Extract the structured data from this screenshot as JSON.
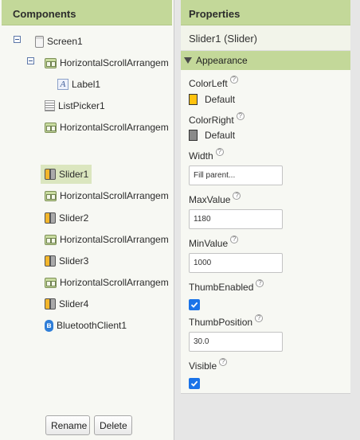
{
  "components": {
    "header": "Components",
    "tree": [
      {
        "label": "Screen1",
        "icon": "screen-icon"
      },
      {
        "label": "HorizontalScrollArrangem",
        "icon": "horizontal-scroll-arrangement-icon"
      },
      {
        "label": "Label1",
        "icon": "label-icon"
      },
      {
        "label": "ListPicker1",
        "icon": "listpicker-icon"
      },
      {
        "label": "HorizontalScrollArrangem",
        "icon": "horizontal-scroll-arrangement-icon"
      },
      {
        "label": "Slider1",
        "icon": "slider-icon",
        "selected": true
      },
      {
        "label": "HorizontalScrollArrangem",
        "icon": "horizontal-scroll-arrangement-icon"
      },
      {
        "label": "Slider2",
        "icon": "slider-icon"
      },
      {
        "label": "HorizontalScrollArrangem",
        "icon": "horizontal-scroll-arrangement-icon"
      },
      {
        "label": "Slider3",
        "icon": "slider-icon"
      },
      {
        "label": "HorizontalScrollArrangem",
        "icon": "horizontal-scroll-arrangement-icon"
      },
      {
        "label": "Slider4",
        "icon": "slider-icon"
      },
      {
        "label": "BluetoothClient1",
        "icon": "bluetooth-icon"
      }
    ],
    "rename_label": "Rename",
    "delete_label": "Delete"
  },
  "properties": {
    "header": "Properties",
    "component_title": "Slider1 (Slider)",
    "section": "Appearance",
    "help_glyph": "?",
    "color_left": {
      "name": "ColorLeft",
      "value": "Default",
      "color": "#ffc20e"
    },
    "color_right": {
      "name": "ColorRight",
      "value": "Default",
      "color": "#8a8a8a"
    },
    "width": {
      "name": "Width",
      "value": "Fill parent..."
    },
    "max_value": {
      "name": "MaxValue",
      "value": "1180"
    },
    "min_value": {
      "name": "MinValue",
      "value": "1000"
    },
    "thumb_enabled": {
      "name": "ThumbEnabled",
      "checked": true
    },
    "thumb_position": {
      "name": "ThumbPosition",
      "value": "30.0"
    },
    "visible": {
      "name": "Visible",
      "checked": true
    }
  },
  "colors": {
    "accent_header": "#c3d899",
    "checkbox": "#1a73e8"
  }
}
